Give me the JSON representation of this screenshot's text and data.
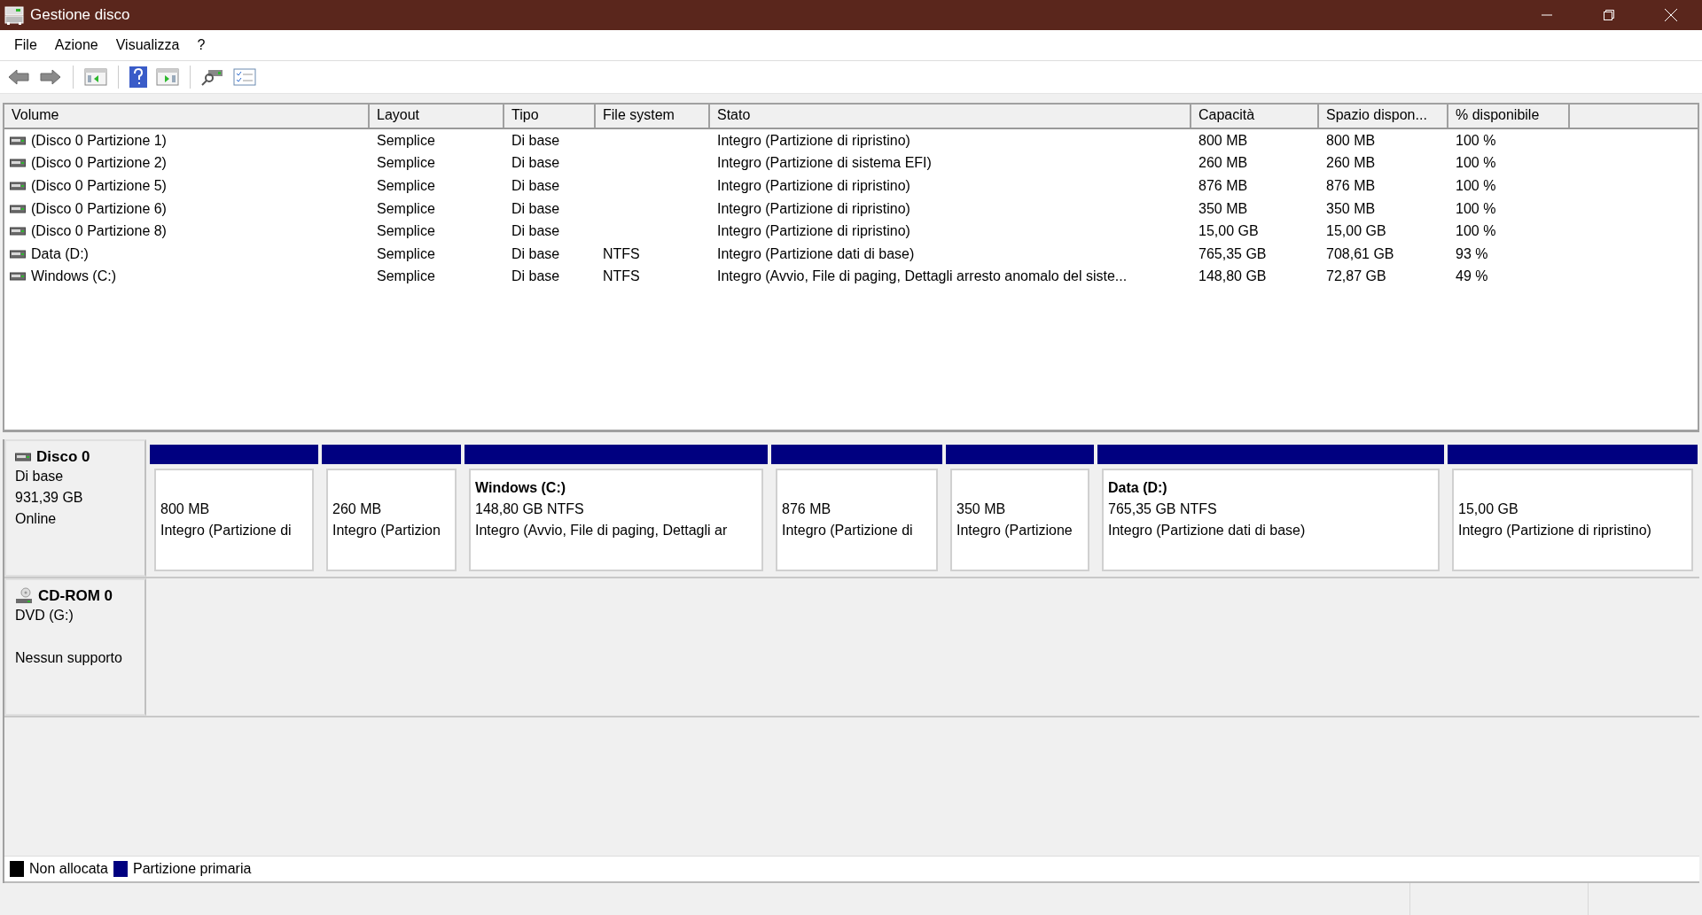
{
  "window": {
    "title": "Gestione disco"
  },
  "menu": [
    "File",
    "Azione",
    "Visualizza",
    "?"
  ],
  "table": {
    "columns": [
      "Volume",
      "Layout",
      "Tipo",
      "File system",
      "Stato",
      "Capacità",
      "Spazio dispon...",
      "% disponibile"
    ],
    "rows": [
      [
        "(Disco 0 Partizione 1)",
        "Semplice",
        "Di base",
        "",
        "Integro (Partizione di ripristino)",
        "800 MB",
        "800 MB",
        "100 %"
      ],
      [
        "(Disco 0 Partizione 2)",
        "Semplice",
        "Di base",
        "",
        "Integro (Partizione di sistema EFI)",
        "260 MB",
        "260 MB",
        "100 %"
      ],
      [
        "(Disco 0 Partizione 5)",
        "Semplice",
        "Di base",
        "",
        "Integro (Partizione di ripristino)",
        "876 MB",
        "876 MB",
        "100 %"
      ],
      [
        "(Disco 0 Partizione 6)",
        "Semplice",
        "Di base",
        "",
        "Integro (Partizione di ripristino)",
        "350 MB",
        "350 MB",
        "100 %"
      ],
      [
        "(Disco 0 Partizione 8)",
        "Semplice",
        "Di base",
        "",
        "Integro (Partizione di ripristino)",
        "15,00 GB",
        "15,00 GB",
        "100 %"
      ],
      [
        "Data (D:)",
        "Semplice",
        "Di base",
        "NTFS",
        "Integro (Partizione dati di base)",
        "765,35 GB",
        "708,61 GB",
        "93 %"
      ],
      [
        "Windows (C:)",
        "Semplice",
        "Di base",
        "NTFS",
        "Integro (Avvio, File di paging, Dettagli arresto anomalo del siste...",
        "148,80 GB",
        "72,87 GB",
        "49 %"
      ]
    ]
  },
  "disks": [
    {
      "kind": "hdd",
      "name": "Disco 0",
      "lines": [
        "Di base",
        "931,39 GB",
        "Online"
      ],
      "partitions": [
        {
          "size": "800 MB",
          "status": "Integro (Partizione di",
          "color": "#000080"
        },
        {
          "size": "260 MB",
          "status": "Integro (Partizion",
          "color": "#000080"
        },
        {
          "title": "Windows  (C:)",
          "size": "148,80 GB NTFS",
          "status": "Integro (Avvio, File di paging, Dettagli ar",
          "color": "#000080"
        },
        {
          "size": "876 MB",
          "status": "Integro (Partizione di",
          "color": "#000080"
        },
        {
          "size": "350 MB",
          "status": "Integro (Partizione",
          "color": "#000080"
        },
        {
          "title": "Data  (D:)",
          "size": "765,35 GB NTFS",
          "status": "Integro (Partizione dati di base)",
          "color": "#000080"
        },
        {
          "size": "15,00 GB",
          "status": "Integro (Partizione di ripristino)",
          "color": "#000080"
        }
      ]
    },
    {
      "kind": "cdrom",
      "name": "CD-ROM 0",
      "lines": [
        "DVD (G:)",
        "Nessun supporto"
      ]
    }
  ],
  "legend": [
    {
      "label": "Non allocata",
      "color": "#000000"
    },
    {
      "label": "Partizione primaria",
      "color": "#000080"
    }
  ]
}
